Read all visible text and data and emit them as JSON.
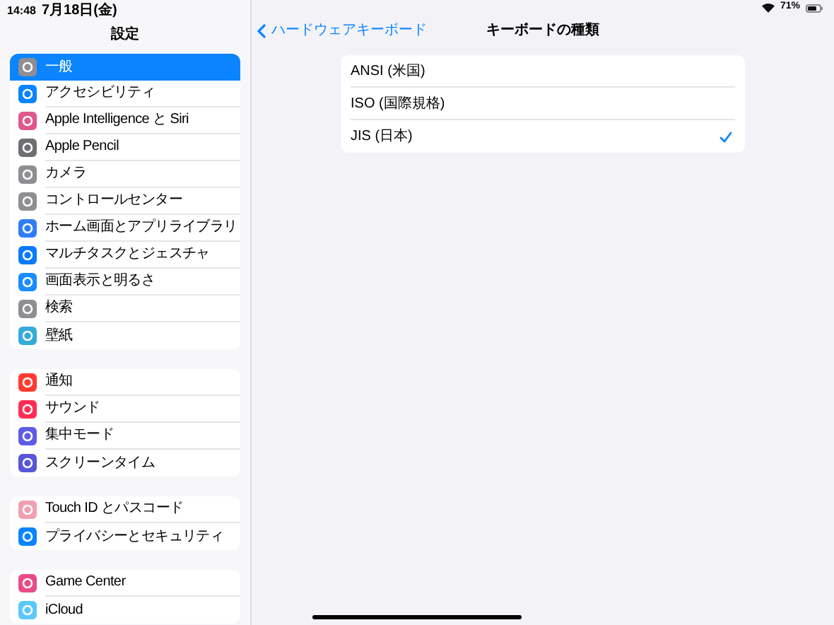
{
  "status_bar": {
    "time": "14:48",
    "date": "7月18日(金)",
    "battery": "71%"
  },
  "sidebar": {
    "title": "設定",
    "groups": [
      [
        {
          "label": "一般",
          "color": "#8e8e93",
          "selected": true
        },
        {
          "label": "アクセシビリティ",
          "color": "#0a84ff",
          "selected": false
        },
        {
          "label": "Apple Intelligence と Siri",
          "color": "#e0568f",
          "selected": false
        },
        {
          "label": "Apple Pencil",
          "color": "#6e6e73",
          "selected": false
        },
        {
          "label": "カメラ",
          "color": "#8e8e93",
          "selected": false
        },
        {
          "label": "コントロールセンター",
          "color": "#8e8e93",
          "selected": false
        },
        {
          "label": "ホーム画面とアプリライブラリ",
          "color": "#2f7cf6",
          "selected": false
        },
        {
          "label": "マルチタスクとジェスチャ",
          "color": "#0a7aff",
          "selected": false
        },
        {
          "label": "画面表示と明るさ",
          "color": "#1a8cff",
          "selected": false
        },
        {
          "label": "検索",
          "color": "#8e8e93",
          "selected": false
        },
        {
          "label": "壁紙",
          "color": "#35aadc",
          "selected": false
        }
      ],
      [
        {
          "label": "通知",
          "color": "#ff3b30",
          "selected": false
        },
        {
          "label": "サウンド",
          "color": "#ff2d55",
          "selected": false
        },
        {
          "label": "集中モード",
          "color": "#5e5ce6",
          "selected": false
        },
        {
          "label": "スクリーンタイム",
          "color": "#5856d6",
          "selected": false
        }
      ],
      [
        {
          "label": "Touch ID とパスコード",
          "color": "#f0a0b0",
          "selected": false
        },
        {
          "label": "プライバシーとセキュリティ",
          "color": "#0a84ff",
          "selected": false
        }
      ],
      [
        {
          "label": "Game Center",
          "color": "#e94b8a",
          "selected": false
        },
        {
          "label": "iCloud",
          "color": "#5ac8fa",
          "selected": false
        }
      ]
    ]
  },
  "detail": {
    "back": "ハードウェアキーボード",
    "title": "キーボードの種類",
    "options": [
      {
        "label": "ANSI (米国)",
        "selected": false
      },
      {
        "label": "ISO (国際規格)",
        "selected": false
      },
      {
        "label": "JIS (日本)",
        "selected": true
      }
    ]
  }
}
